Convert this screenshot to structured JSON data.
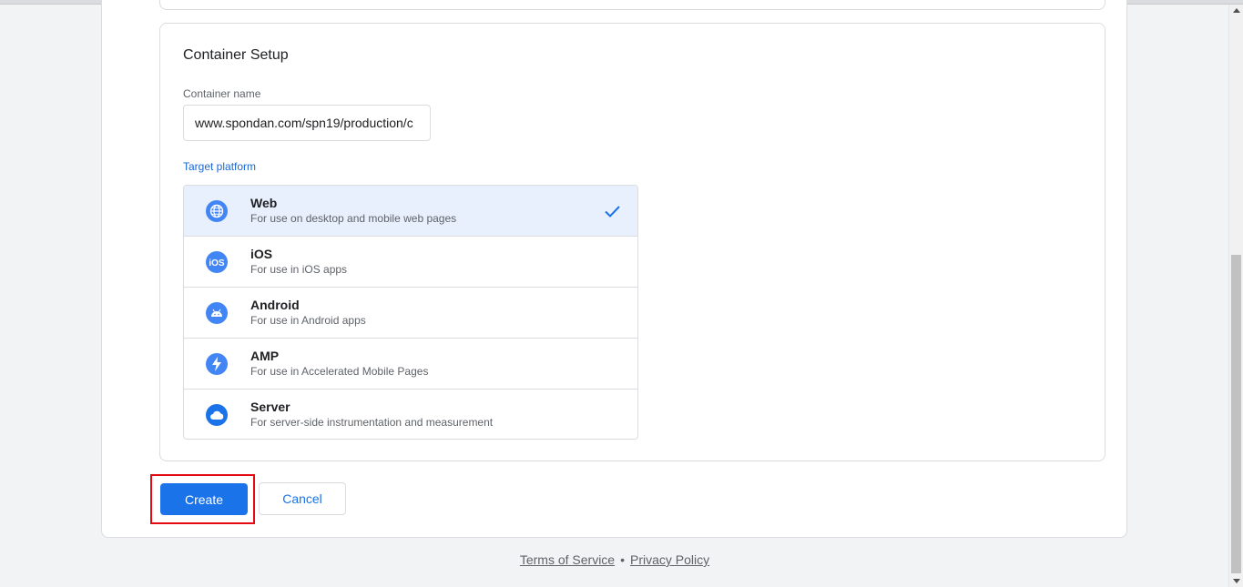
{
  "setup": {
    "title": "Container Setup",
    "name_label": "Container name",
    "name_value": "www.spondan.com/spn19/production/c",
    "platform_label": "Target platform"
  },
  "platforms": [
    {
      "name": "Web",
      "desc": "For use on desktop and mobile web pages",
      "icon": "globe-icon",
      "selected": true
    },
    {
      "name": "iOS",
      "desc": "For use in iOS apps",
      "icon": "ios-icon",
      "selected": false
    },
    {
      "name": "Android",
      "desc": "For use in Android apps",
      "icon": "android-icon",
      "selected": false
    },
    {
      "name": "AMP",
      "desc": "For use in Accelerated Mobile Pages",
      "icon": "amp-bolt-icon",
      "selected": false
    },
    {
      "name": "Server",
      "desc": "For server-side instrumentation and measurement",
      "icon": "cloud-icon",
      "selected": false
    }
  ],
  "actions": {
    "create_label": "Create",
    "cancel_label": "Cancel"
  },
  "footer": {
    "terms": "Terms of Service",
    "separator": "•",
    "privacy": "Privacy Policy"
  },
  "colors": {
    "accent": "#1a73e8",
    "highlight": "#e50914",
    "selected_bg": "#e8f0fe"
  }
}
